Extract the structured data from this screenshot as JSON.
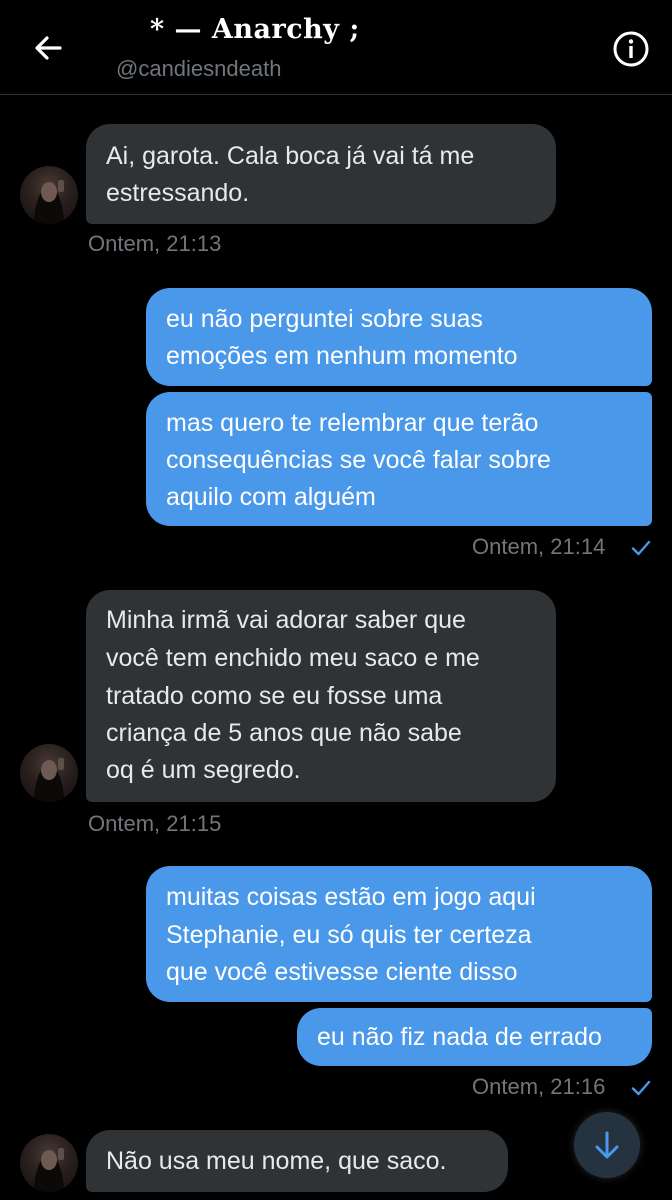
{
  "header": {
    "title": "* — Anarchy ;",
    "handle": "@candiesndeath"
  },
  "messages": [
    {
      "from": "them",
      "lines": [
        "Ai, garota. Cala boca já vai tá me",
        "estressando."
      ]
    },
    {
      "from": "them_time",
      "text": "Ontem, 21:13"
    },
    {
      "from": "me",
      "lines": [
        "eu não perguntei sobre suas",
        "emoções em nenhum momento"
      ]
    },
    {
      "from": "me",
      "lines": [
        "mas quero te relembrar que terão",
        "consequências se você falar sobre",
        "aquilo com alguém"
      ]
    },
    {
      "from": "me_time",
      "text": "Ontem, 21:14"
    },
    {
      "from": "them",
      "lines": [
        "Minha irmã vai adorar saber que",
        "você tem enchido meu saco e me",
        "tratado como se eu fosse uma",
        "criança de 5 anos que não sabe",
        "oq é um segredo."
      ]
    },
    {
      "from": "them_time",
      "text": "Ontem, 21:15"
    },
    {
      "from": "me",
      "lines": [
        "muitas coisas estão em jogo aqui",
        "Stephanie, eu só quis ter certeza",
        "que você estivesse ciente disso"
      ]
    },
    {
      "from": "me",
      "lines": [
        "eu não fiz nada de errado"
      ]
    },
    {
      "from": "me_time",
      "text": "Ontem, 21:16"
    },
    {
      "from": "them",
      "lines": [
        "Não usa meu nome, que saco."
      ]
    }
  ],
  "colors": {
    "background": "#000000",
    "received_bubble": "#2f3336",
    "sent_bubble": "#4a98ea",
    "timestamp": "#71767b",
    "read_check": "#4a98ea"
  },
  "icons": {
    "back": "arrow-left-icon",
    "info": "info-circle-icon",
    "read": "checkmark-icon",
    "scroll_down": "arrow-down-icon"
  }
}
